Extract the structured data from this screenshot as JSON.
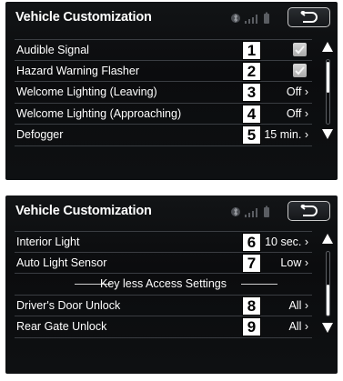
{
  "screens": [
    {
      "title": "Vehicle Customization",
      "rows": [
        {
          "label": "Audible Signal",
          "callout": "1",
          "value": "",
          "checked": true
        },
        {
          "label": "Hazard Warning Flasher",
          "callout": "2",
          "value": "",
          "checked": true
        },
        {
          "label": "Welcome Lighting (Leaving)",
          "callout": "3",
          "value": "Off ›",
          "checked": false
        },
        {
          "label": "Welcome Lighting (Approaching)",
          "callout": "4",
          "value": "Off ›",
          "checked": false
        },
        {
          "label": "Defogger",
          "callout": "5",
          "value": "15 min. ›",
          "checked": false
        }
      ]
    },
    {
      "title": "Vehicle Customization",
      "rows": [
        {
          "label": "Interior Light",
          "callout": "6",
          "value": "10 sec. ›"
        },
        {
          "label": "Auto Light Sensor",
          "callout": "7",
          "value": "Low ›"
        }
      ],
      "section_label": "Key less Access Settings",
      "rows_after_section": [
        {
          "label": "Driver's Door Unlock",
          "callout": "8",
          "value": "All ›"
        },
        {
          "label": "Rear Gate Unlock",
          "callout": "9",
          "value": "All ›"
        }
      ]
    }
  ],
  "icons": {
    "bluetooth": "bluetooth-icon",
    "signal": "signal-strength-icon",
    "battery": "battery-icon",
    "back": "back-arrow-icon",
    "check": "check-icon",
    "scroll_up": "scroll-up-icon",
    "scroll_down": "scroll-down-icon"
  },
  "colors": {
    "screen_background": "#0e1012",
    "text": "#ffffff",
    "divider": "#3a3d42",
    "checkbox": "#bdbdbd",
    "callout_border": "#000000"
  }
}
